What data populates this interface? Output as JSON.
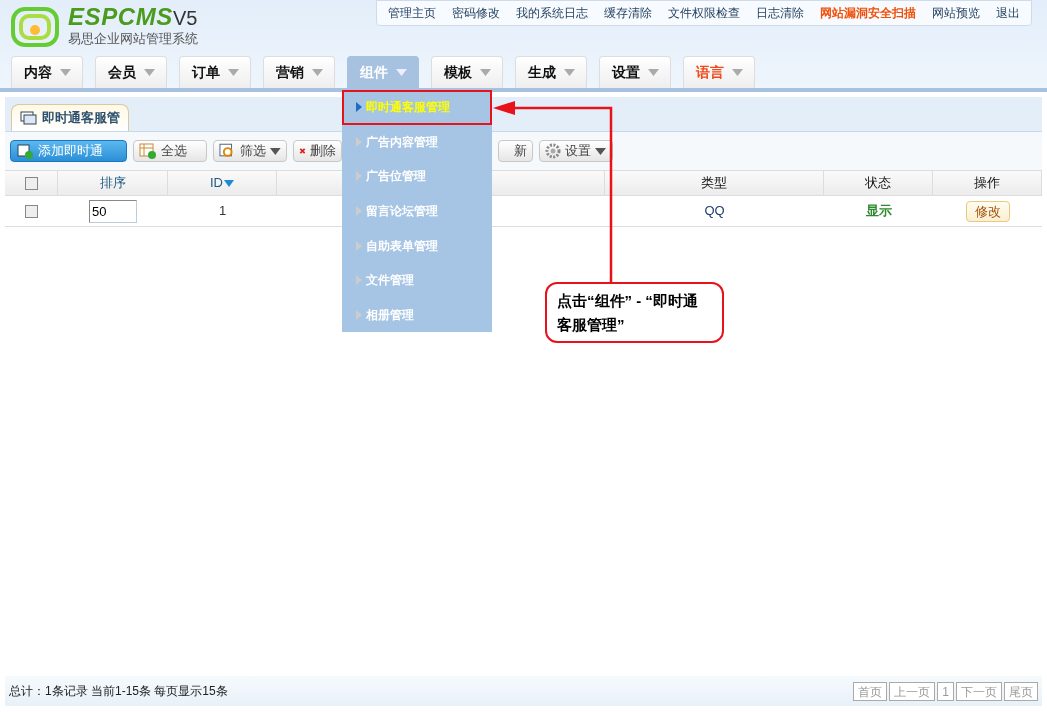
{
  "logo": {
    "brand": "ESPCMS",
    "version": "V5",
    "subtitle": "易思企业网站管理系统"
  },
  "top_links": [
    {
      "label": "管理主页",
      "highlight": false
    },
    {
      "label": "密码修改",
      "highlight": false
    },
    {
      "label": "我的系统日志",
      "highlight": false
    },
    {
      "label": "缓存清除",
      "highlight": false
    },
    {
      "label": "文件权限检查",
      "highlight": false
    },
    {
      "label": "日志清除",
      "highlight": false
    },
    {
      "label": "网站漏洞安全扫描",
      "highlight": true
    },
    {
      "label": "网站预览",
      "highlight": false
    },
    {
      "label": "退出",
      "highlight": false
    }
  ],
  "nav": [
    {
      "label": "内容",
      "selected": false,
      "highlight": false
    },
    {
      "label": "会员",
      "selected": false,
      "highlight": false
    },
    {
      "label": "订单",
      "selected": false,
      "highlight": false
    },
    {
      "label": "营销",
      "selected": false,
      "highlight": false
    },
    {
      "label": "组件",
      "selected": true,
      "highlight": false
    },
    {
      "label": "模板",
      "selected": false,
      "highlight": false
    },
    {
      "label": "生成",
      "selected": false,
      "highlight": false
    },
    {
      "label": "设置",
      "selected": false,
      "highlight": false
    },
    {
      "label": "语言",
      "selected": false,
      "highlight": true
    }
  ],
  "dropdown": [
    {
      "label": "即时通客服管理",
      "selected": true
    },
    {
      "label": "广告内容管理",
      "selected": false
    },
    {
      "label": "广告位管理",
      "selected": false
    },
    {
      "label": "留言论坛管理",
      "selected": false
    },
    {
      "label": "自助表单管理",
      "selected": false
    },
    {
      "label": "文件管理",
      "selected": false
    },
    {
      "label": "相册管理",
      "selected": false
    }
  ],
  "page_tab": "即时通客服管",
  "toolbar": [
    {
      "kind": "primary",
      "label": "添加即时通"
    },
    {
      "kind": "select",
      "label": "全选"
    },
    {
      "kind": "filter",
      "label": "筛选"
    },
    {
      "kind": "delete",
      "label": "删除"
    },
    {
      "kind": "refresh",
      "label": "新"
    },
    {
      "kind": "settings",
      "label": "设置"
    }
  ],
  "table": {
    "columns": [
      {
        "label": "排序"
      },
      {
        "label": "ID"
      },
      {},
      {
        "label": "类型"
      },
      {
        "label": "状态"
      },
      {
        "label": "操作"
      }
    ],
    "rows": [
      {
        "checked": false,
        "order": "50",
        "id": "1",
        "type": "QQ",
        "status": "显示",
        "action": "修改"
      }
    ]
  },
  "header_checkbox": {
    "checked": false
  },
  "annotation": "点击“组件” - “即时通客服管理”",
  "footer": {
    "summary": "总计：1条记录 当前1-15条 每页显示15条",
    "pager": [
      {
        "label": "首页",
        "selected": false
      },
      {
        "label": "上一页",
        "selected": false
      },
      {
        "label": "1",
        "selected": false
      },
      {
        "label": "下一页",
        "selected": false
      },
      {
        "label": "尾页",
        "selected": false
      }
    ]
  }
}
